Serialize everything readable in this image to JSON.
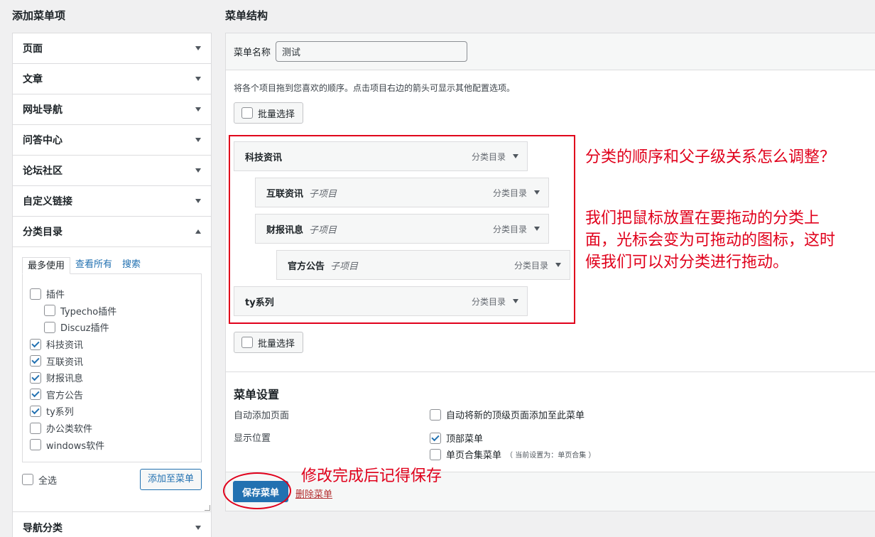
{
  "left": {
    "title": "添加菜单项",
    "accordion": [
      "页面",
      "文章",
      "网址导航",
      "问答中心",
      "论坛社区",
      "自定义链接"
    ],
    "open_section": "分类目录",
    "tabs": [
      "最多使用",
      "查看所有",
      "搜索"
    ],
    "categories": [
      {
        "label": "插件",
        "checked": false,
        "child": false
      },
      {
        "label": "Typecho插件",
        "checked": false,
        "child": true
      },
      {
        "label": "Discuz插件",
        "checked": false,
        "child": true
      },
      {
        "label": "科技资讯",
        "checked": true,
        "child": false
      },
      {
        "label": "互联资讯",
        "checked": true,
        "child": false
      },
      {
        "label": "财报讯息",
        "checked": true,
        "child": false
      },
      {
        "label": "官方公告",
        "checked": true,
        "child": false
      },
      {
        "label": "ty系列",
        "checked": true,
        "child": false
      },
      {
        "label": "办公类软件",
        "checked": false,
        "child": false
      },
      {
        "label": "windows软件",
        "checked": false,
        "child": false
      }
    ],
    "select_all": "全选",
    "add_button": "添加至菜单",
    "last_section": "导航分类"
  },
  "right": {
    "title": "菜单结构",
    "name_label": "菜单名称",
    "name_value": "测试",
    "instructions": "将各个项目拖到您喜欢的顺序。点击项目右边的箭头可显示其他配置选项。",
    "bulk_select": "批量选择",
    "items": [
      {
        "title": "科技资讯",
        "sub": "",
        "type": "分类目录"
      },
      {
        "title": "互联资讯",
        "sub": "子项目",
        "type": "分类目录"
      },
      {
        "title": "财报讯息",
        "sub": "子项目",
        "type": "分类目录"
      },
      {
        "title": "官方公告",
        "sub": "子项目",
        "type": "分类目录"
      },
      {
        "title": "ty系列",
        "sub": "",
        "type": "分类目录"
      }
    ],
    "settings_title": "菜单设置",
    "auto_add_label": "自动添加页面",
    "auto_add_option": "自动将新的顶级页面添加至此菜单",
    "location_label": "显示位置",
    "location_options": [
      {
        "label": "顶部菜单",
        "checked": true,
        "note": ""
      },
      {
        "label": "单页合集菜单",
        "checked": false,
        "note": "（ 当前设置为：单页合集 ）"
      }
    ],
    "save_button": "保存菜单",
    "delete_link": "删除菜单"
  },
  "annotations": {
    "note1": "分类的顺序和父子级关系怎么调整？",
    "note2": "我们把鼠标放置在要拖动的分类上面，光标会变为可拖动的图标，这时候我们可以对分类进行拖动。",
    "note3": "修改完成后记得保存"
  },
  "colors": {
    "accent": "#2271b1",
    "annotation": "#e0001b",
    "danger": "#b32d2e"
  }
}
